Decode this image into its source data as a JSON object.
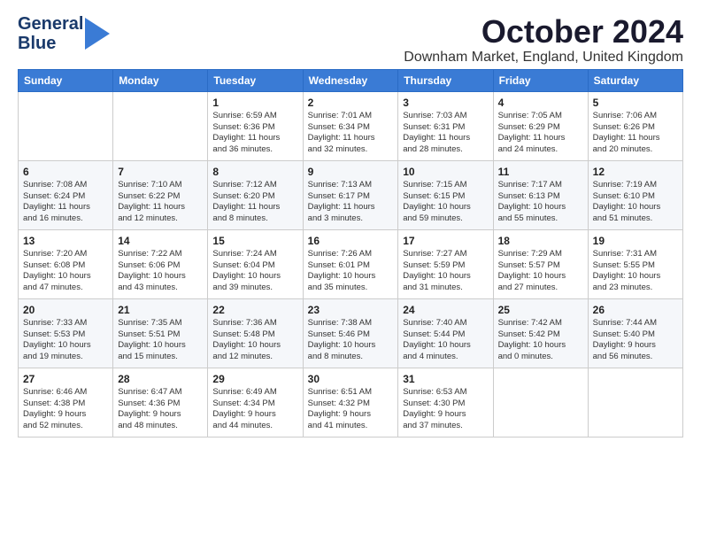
{
  "logo": {
    "line1": "General",
    "line2": "Blue"
  },
  "title": "October 2024",
  "location": "Downham Market, England, United Kingdom",
  "headers": [
    "Sunday",
    "Monday",
    "Tuesday",
    "Wednesday",
    "Thursday",
    "Friday",
    "Saturday"
  ],
  "weeks": [
    [
      {
        "day": "",
        "info": ""
      },
      {
        "day": "",
        "info": ""
      },
      {
        "day": "1",
        "info": "Sunrise: 6:59 AM\nSunset: 6:36 PM\nDaylight: 11 hours\nand 36 minutes."
      },
      {
        "day": "2",
        "info": "Sunrise: 7:01 AM\nSunset: 6:34 PM\nDaylight: 11 hours\nand 32 minutes."
      },
      {
        "day": "3",
        "info": "Sunrise: 7:03 AM\nSunset: 6:31 PM\nDaylight: 11 hours\nand 28 minutes."
      },
      {
        "day": "4",
        "info": "Sunrise: 7:05 AM\nSunset: 6:29 PM\nDaylight: 11 hours\nand 24 minutes."
      },
      {
        "day": "5",
        "info": "Sunrise: 7:06 AM\nSunset: 6:26 PM\nDaylight: 11 hours\nand 20 minutes."
      }
    ],
    [
      {
        "day": "6",
        "info": "Sunrise: 7:08 AM\nSunset: 6:24 PM\nDaylight: 11 hours\nand 16 minutes."
      },
      {
        "day": "7",
        "info": "Sunrise: 7:10 AM\nSunset: 6:22 PM\nDaylight: 11 hours\nand 12 minutes."
      },
      {
        "day": "8",
        "info": "Sunrise: 7:12 AM\nSunset: 6:20 PM\nDaylight: 11 hours\nand 8 minutes."
      },
      {
        "day": "9",
        "info": "Sunrise: 7:13 AM\nSunset: 6:17 PM\nDaylight: 11 hours\nand 3 minutes."
      },
      {
        "day": "10",
        "info": "Sunrise: 7:15 AM\nSunset: 6:15 PM\nDaylight: 10 hours\nand 59 minutes."
      },
      {
        "day": "11",
        "info": "Sunrise: 7:17 AM\nSunset: 6:13 PM\nDaylight: 10 hours\nand 55 minutes."
      },
      {
        "day": "12",
        "info": "Sunrise: 7:19 AM\nSunset: 6:10 PM\nDaylight: 10 hours\nand 51 minutes."
      }
    ],
    [
      {
        "day": "13",
        "info": "Sunrise: 7:20 AM\nSunset: 6:08 PM\nDaylight: 10 hours\nand 47 minutes."
      },
      {
        "day": "14",
        "info": "Sunrise: 7:22 AM\nSunset: 6:06 PM\nDaylight: 10 hours\nand 43 minutes."
      },
      {
        "day": "15",
        "info": "Sunrise: 7:24 AM\nSunset: 6:04 PM\nDaylight: 10 hours\nand 39 minutes."
      },
      {
        "day": "16",
        "info": "Sunrise: 7:26 AM\nSunset: 6:01 PM\nDaylight: 10 hours\nand 35 minutes."
      },
      {
        "day": "17",
        "info": "Sunrise: 7:27 AM\nSunset: 5:59 PM\nDaylight: 10 hours\nand 31 minutes."
      },
      {
        "day": "18",
        "info": "Sunrise: 7:29 AM\nSunset: 5:57 PM\nDaylight: 10 hours\nand 27 minutes."
      },
      {
        "day": "19",
        "info": "Sunrise: 7:31 AM\nSunset: 5:55 PM\nDaylight: 10 hours\nand 23 minutes."
      }
    ],
    [
      {
        "day": "20",
        "info": "Sunrise: 7:33 AM\nSunset: 5:53 PM\nDaylight: 10 hours\nand 19 minutes."
      },
      {
        "day": "21",
        "info": "Sunrise: 7:35 AM\nSunset: 5:51 PM\nDaylight: 10 hours\nand 15 minutes."
      },
      {
        "day": "22",
        "info": "Sunrise: 7:36 AM\nSunset: 5:48 PM\nDaylight: 10 hours\nand 12 minutes."
      },
      {
        "day": "23",
        "info": "Sunrise: 7:38 AM\nSunset: 5:46 PM\nDaylight: 10 hours\nand 8 minutes."
      },
      {
        "day": "24",
        "info": "Sunrise: 7:40 AM\nSunset: 5:44 PM\nDaylight: 10 hours\nand 4 minutes."
      },
      {
        "day": "25",
        "info": "Sunrise: 7:42 AM\nSunset: 5:42 PM\nDaylight: 10 hours\nand 0 minutes."
      },
      {
        "day": "26",
        "info": "Sunrise: 7:44 AM\nSunset: 5:40 PM\nDaylight: 9 hours\nand 56 minutes."
      }
    ],
    [
      {
        "day": "27",
        "info": "Sunrise: 6:46 AM\nSunset: 4:38 PM\nDaylight: 9 hours\nand 52 minutes."
      },
      {
        "day": "28",
        "info": "Sunrise: 6:47 AM\nSunset: 4:36 PM\nDaylight: 9 hours\nand 48 minutes."
      },
      {
        "day": "29",
        "info": "Sunrise: 6:49 AM\nSunset: 4:34 PM\nDaylight: 9 hours\nand 44 minutes."
      },
      {
        "day": "30",
        "info": "Sunrise: 6:51 AM\nSunset: 4:32 PM\nDaylight: 9 hours\nand 41 minutes."
      },
      {
        "day": "31",
        "info": "Sunrise: 6:53 AM\nSunset: 4:30 PM\nDaylight: 9 hours\nand 37 minutes."
      },
      {
        "day": "",
        "info": ""
      },
      {
        "day": "",
        "info": ""
      }
    ]
  ]
}
